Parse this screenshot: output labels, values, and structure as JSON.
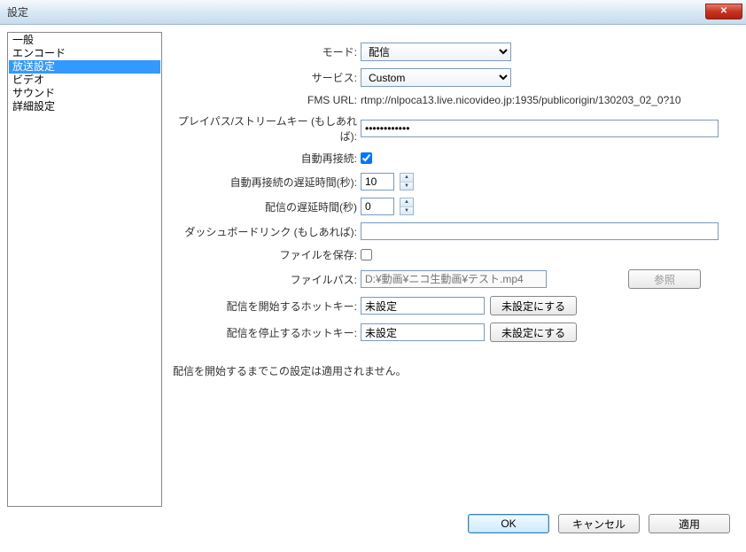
{
  "window": {
    "title": "設定"
  },
  "sidebar": {
    "items": [
      {
        "label": "一般"
      },
      {
        "label": "エンコード"
      },
      {
        "label": "放送設定",
        "selected": true
      },
      {
        "label": "ビデオ"
      },
      {
        "label": "サウンド"
      },
      {
        "label": "詳細設定"
      }
    ]
  },
  "form": {
    "mode": {
      "label": "モード:",
      "value": "配信"
    },
    "service": {
      "label": "サービス:",
      "value": "Custom"
    },
    "fms_url": {
      "label": "FMS URL:",
      "value": "rtmp://nlpoca13.live.nicovideo.jp:1935/publicorigin/130203_02_0?10"
    },
    "stream_key": {
      "label": "プレイパス/ストリームキー (もしあれば):",
      "value": "••••••••••••"
    },
    "auto_reconnect": {
      "label": "自動再接続:",
      "checked": true
    },
    "reconnect_delay": {
      "label": "自動再接続の遅延時間(秒):",
      "value": "10"
    },
    "stream_delay": {
      "label": "配信の遅延時間(秒)",
      "value": "0"
    },
    "dashboard_link": {
      "label": "ダッシュボードリンク (もしあれば):",
      "value": ""
    },
    "save_file": {
      "label": "ファイルを保存:",
      "checked": false
    },
    "file_path": {
      "label": "ファイルパス:",
      "value": "",
      "placeholder": "D:¥動画¥ニコ生動画¥テスト.mp4",
      "browse": "参照"
    },
    "start_hotkey": {
      "label": "配信を開始するホットキー:",
      "value": "未設定",
      "reset": "未設定にする"
    },
    "stop_hotkey": {
      "label": "配信を停止するホットキー:",
      "value": "未設定",
      "reset": "未設定にする"
    },
    "note": "配信を開始するまでこの設定は適用されません。"
  },
  "buttons": {
    "ok": "OK",
    "cancel": "キャンセル",
    "apply": "適用"
  }
}
